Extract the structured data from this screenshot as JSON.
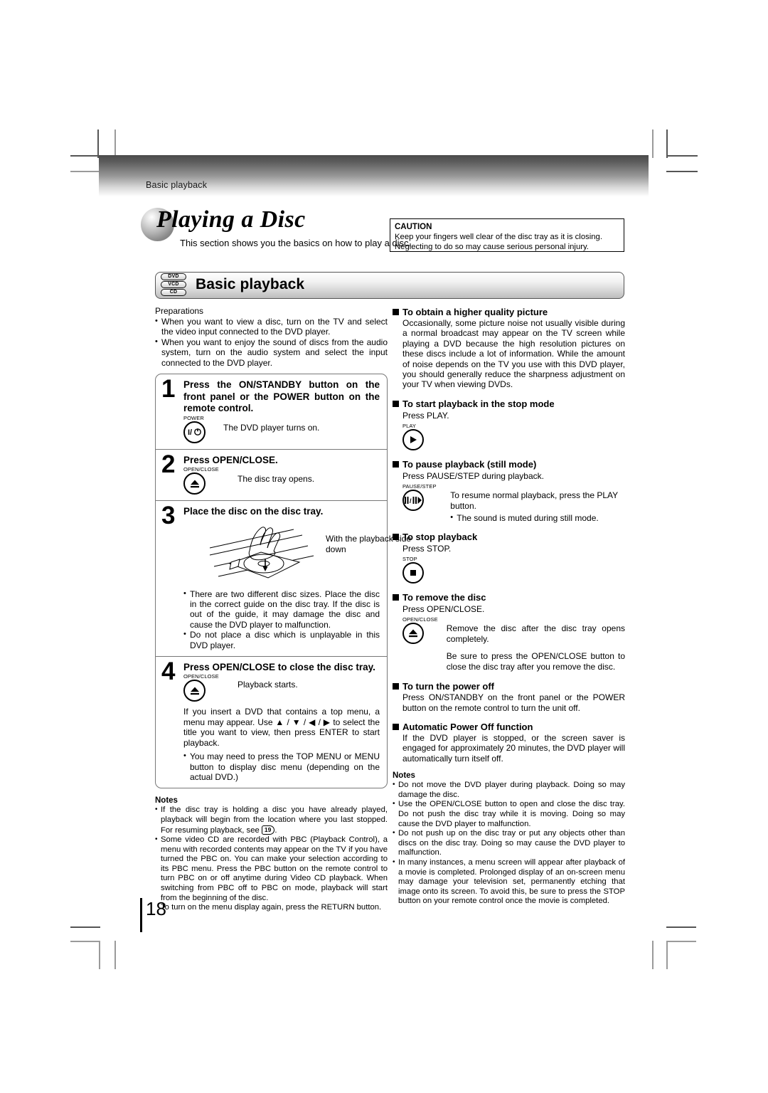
{
  "header": {
    "running_head": "Basic playback"
  },
  "title": {
    "heading": "Playing a Disc",
    "subtitle": "This section shows you the basics on how to play a disc."
  },
  "caution": {
    "label": "CAUTION",
    "line1": "Keep your fingers well clear of the disc tray as it is closing.",
    "line2": "Neglecting to do so may cause serious personal injury."
  },
  "section": {
    "title": "Basic playback",
    "badges": [
      "DVD",
      "VCD",
      "CD"
    ]
  },
  "left": {
    "prep_title": "Preparations",
    "prep_items": [
      "When you want to view a disc, turn on the TV and select the video input connected to the DVD player.",
      "When you want to enjoy the sound of discs from the audio system, turn on the audio system and select the input connected to the DVD player."
    ],
    "steps": [
      {
        "num": "1",
        "heading": "Press the ON/STANDBY button on the front panel or the POWER button on the remote control.",
        "key_label": "POWER",
        "key_glyph": "I/⏻",
        "note": "The DVD player turns on."
      },
      {
        "num": "2",
        "heading": "Press OPEN/CLOSE.",
        "key_label": "OPEN/CLOSE",
        "key_glyph": "eject",
        "note": "The disc tray opens."
      },
      {
        "num": "3",
        "heading": "Place the disc on the disc tray.",
        "art_caption": "With the playback side down",
        "bullets": [
          "There are two different disc sizes. Place the disc in the correct guide on the disc tray. If the disc is out of the guide, it may damage the disc and cause the DVD player to malfunction.",
          "Do not place a disc which is unplayable in this DVD player."
        ]
      },
      {
        "num": "4",
        "heading": "Press OPEN/CLOSE to close the disc tray.",
        "key_label": "OPEN/CLOSE",
        "key_glyph": "eject",
        "note": "Playback starts.",
        "para": "If you insert a DVD that contains a top menu, a menu may appear. Use ▲ / ▼ / ◀ / ▶ to select the title you want to view, then press ENTER to start playback.",
        "bullets": [
          "You may need to press the TOP MENU or MENU button to display disc menu (depending on the actual DVD.)"
        ]
      }
    ],
    "notes_title": "Notes",
    "notes": [
      {
        "text_before": "If the disc tray is holding a disc you have already played, playback will begin from the location where you last stopped. For resuming playback, see",
        "page_ref": "19",
        "text_after": "."
      },
      {
        "text": "Some video CD are recorded with PBC (Playback Control), a menu with recorded contents may appear on the TV if you have turned the PBC on. You can make your selection according to its PBC menu. Press the PBC button on the remote control to turn PBC on or off anytime during Video CD playback. When switching from PBC off to PBC on mode, playback will start from the beginning of the disc."
      }
    ],
    "notes_continuation": "To turn on the menu display again, press the RETURN button."
  },
  "right": {
    "sections": [
      {
        "heading": "To obtain a higher quality picture",
        "body": "Occasionally, some picture noise not usually visible during a normal broadcast may appear on the TV screen while playing a DVD because the high resolution pictures on these discs include a lot of information. While the amount of noise depends on the TV you use with this DVD player, you should generally reduce the sharpness adjustment on your TV when viewing DVDs."
      },
      {
        "heading": "To start playback in the stop mode",
        "press": "Press PLAY.",
        "key_label": "PLAY",
        "key_glyph": "play"
      },
      {
        "heading": "To pause playback (still mode)",
        "press": "Press PAUSE/STEP during playback.",
        "key_label": "PAUSE/STEP",
        "key_glyph": "pause",
        "note_lines": [
          "To resume normal playback, press the PLAY button."
        ],
        "note_bullets": [
          "The sound is muted during still mode."
        ]
      },
      {
        "heading": "To stop playback",
        "press": "Press STOP.",
        "key_label": "STOP",
        "key_glyph": "stop"
      },
      {
        "heading": "To remove the disc",
        "press": "Press OPEN/CLOSE.",
        "key_label": "OPEN/CLOSE",
        "key_glyph": "eject",
        "note_lines": [
          "Remove the disc after the disc tray opens completely.",
          "Be sure to press the OPEN/CLOSE button to close the disc tray after you remove the disc."
        ]
      },
      {
        "heading": "To turn the power off",
        "body": "Press ON/STANDBY on the front panel or the POWER button on the remote control to turn the unit off."
      },
      {
        "heading": "Automatic Power Off function",
        "body": "If the DVD player is stopped, or the screen saver is engaged for approximately 20 minutes, the DVD player will automatically turn itself off."
      }
    ],
    "notes_title": "Notes",
    "notes": [
      "Do not move the DVD player during playback. Doing so may damage the disc.",
      "Use the OPEN/CLOSE button to open and close the disc tray. Do not push the disc tray while it is moving. Doing so may cause the DVD player to malfunction.",
      "Do not push up on the disc tray or put any objects other than discs on the disc tray. Doing so may cause the DVD player to malfunction.",
      "In many instances, a menu screen will appear after playback of a movie is completed. Prolonged display of an on-screen menu may damage your television set, permanently etching that image onto its screen. To avoid this, be sure to press the STOP button on your remote control once the movie is completed."
    ]
  },
  "footer": {
    "page_number": "18"
  }
}
